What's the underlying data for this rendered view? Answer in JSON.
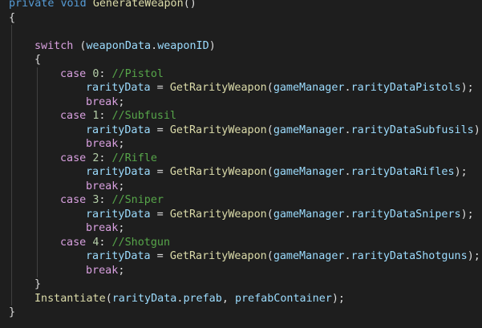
{
  "editor": {
    "lines": [
      {
        "indent": 0,
        "tokens": [
          {
            "t": "private",
            "c": "kw"
          },
          {
            "t": " ",
            "c": "punc"
          },
          {
            "t": "void",
            "c": "kw"
          },
          {
            "t": " ",
            "c": "punc"
          },
          {
            "t": "GenerateWeapon",
            "c": "fn"
          },
          {
            "t": "()",
            "c": "punc"
          }
        ]
      },
      {
        "indent": 0,
        "tokens": [
          {
            "t": "{",
            "c": "punc"
          }
        ]
      },
      {
        "indent": 0,
        "tokens": []
      },
      {
        "indent": 1,
        "tokens": [
          {
            "t": "switch",
            "c": "ctrl"
          },
          {
            "t": " (",
            "c": "punc"
          },
          {
            "t": "weaponData",
            "c": "var"
          },
          {
            "t": ".",
            "c": "punc"
          },
          {
            "t": "weaponID",
            "c": "var"
          },
          {
            "t": ")",
            "c": "punc"
          }
        ]
      },
      {
        "indent": 1,
        "tokens": [
          {
            "t": "{",
            "c": "punc"
          }
        ]
      },
      {
        "indent": 2,
        "tokens": [
          {
            "t": "case",
            "c": "ctrl"
          },
          {
            "t": " ",
            "c": "punc"
          },
          {
            "t": "0",
            "c": "num"
          },
          {
            "t": ": ",
            "c": "punc"
          },
          {
            "t": "//Pistol",
            "c": "cmt"
          }
        ]
      },
      {
        "indent": 3,
        "tokens": [
          {
            "t": "rarityData",
            "c": "var"
          },
          {
            "t": " = ",
            "c": "punc"
          },
          {
            "t": "GetRarityWeapon",
            "c": "fn"
          },
          {
            "t": "(",
            "c": "punc"
          },
          {
            "t": "gameManager",
            "c": "var"
          },
          {
            "t": ".",
            "c": "punc"
          },
          {
            "t": "rarityDataPistols",
            "c": "var"
          },
          {
            "t": ");",
            "c": "punc"
          }
        ]
      },
      {
        "indent": 3,
        "tokens": [
          {
            "t": "break",
            "c": "ctrl"
          },
          {
            "t": ";",
            "c": "punc"
          }
        ]
      },
      {
        "indent": 2,
        "tokens": [
          {
            "t": "case",
            "c": "ctrl"
          },
          {
            "t": " ",
            "c": "punc"
          },
          {
            "t": "1",
            "c": "num"
          },
          {
            "t": ": ",
            "c": "punc"
          },
          {
            "t": "//Subfusil",
            "c": "cmt"
          }
        ]
      },
      {
        "indent": 3,
        "tokens": [
          {
            "t": "rarityData",
            "c": "var"
          },
          {
            "t": " = ",
            "c": "punc"
          },
          {
            "t": "GetRarityWeapon",
            "c": "fn"
          },
          {
            "t": "(",
            "c": "punc"
          },
          {
            "t": "gameManager",
            "c": "var"
          },
          {
            "t": ".",
            "c": "punc"
          },
          {
            "t": "rarityDataSubfusils",
            "c": "var"
          },
          {
            "t": ");",
            "c": "punc"
          }
        ]
      },
      {
        "indent": 3,
        "tokens": [
          {
            "t": "break",
            "c": "ctrl"
          },
          {
            "t": ";",
            "c": "punc"
          }
        ]
      },
      {
        "indent": 2,
        "tokens": [
          {
            "t": "case",
            "c": "ctrl"
          },
          {
            "t": " ",
            "c": "punc"
          },
          {
            "t": "2",
            "c": "num"
          },
          {
            "t": ": ",
            "c": "punc"
          },
          {
            "t": "//Rifle",
            "c": "cmt"
          }
        ]
      },
      {
        "indent": 3,
        "tokens": [
          {
            "t": "rarityData",
            "c": "var"
          },
          {
            "t": " = ",
            "c": "punc"
          },
          {
            "t": "GetRarityWeapon",
            "c": "fn"
          },
          {
            "t": "(",
            "c": "punc"
          },
          {
            "t": "gameManager",
            "c": "var"
          },
          {
            "t": ".",
            "c": "punc"
          },
          {
            "t": "rarityDataRifles",
            "c": "var"
          },
          {
            "t": ");",
            "c": "punc"
          }
        ]
      },
      {
        "indent": 3,
        "tokens": [
          {
            "t": "break",
            "c": "ctrl"
          },
          {
            "t": ";",
            "c": "punc"
          }
        ]
      },
      {
        "indent": 2,
        "tokens": [
          {
            "t": "case",
            "c": "ctrl"
          },
          {
            "t": " ",
            "c": "punc"
          },
          {
            "t": "3",
            "c": "num"
          },
          {
            "t": ": ",
            "c": "punc"
          },
          {
            "t": "//Sniper",
            "c": "cmt"
          }
        ]
      },
      {
        "indent": 3,
        "tokens": [
          {
            "t": "rarityData",
            "c": "var"
          },
          {
            "t": " = ",
            "c": "punc"
          },
          {
            "t": "GetRarityWeapon",
            "c": "fn"
          },
          {
            "t": "(",
            "c": "punc"
          },
          {
            "t": "gameManager",
            "c": "var"
          },
          {
            "t": ".",
            "c": "punc"
          },
          {
            "t": "rarityDataSnipers",
            "c": "var"
          },
          {
            "t": ");",
            "c": "punc"
          }
        ]
      },
      {
        "indent": 3,
        "tokens": [
          {
            "t": "break",
            "c": "ctrl"
          },
          {
            "t": ";",
            "c": "punc"
          }
        ]
      },
      {
        "indent": 2,
        "tokens": [
          {
            "t": "case",
            "c": "ctrl"
          },
          {
            "t": " ",
            "c": "punc"
          },
          {
            "t": "4",
            "c": "num"
          },
          {
            "t": ": ",
            "c": "punc"
          },
          {
            "t": "//Shotgun",
            "c": "cmt"
          }
        ]
      },
      {
        "indent": 3,
        "tokens": [
          {
            "t": "rarityData",
            "c": "var"
          },
          {
            "t": " = ",
            "c": "punc"
          },
          {
            "t": "GetRarityWeapon",
            "c": "fn"
          },
          {
            "t": "(",
            "c": "punc"
          },
          {
            "t": "gameManager",
            "c": "var"
          },
          {
            "t": ".",
            "c": "punc"
          },
          {
            "t": "rarityDataShotguns",
            "c": "var"
          },
          {
            "t": ");",
            "c": "punc"
          }
        ]
      },
      {
        "indent": 3,
        "tokens": [
          {
            "t": "break",
            "c": "ctrl"
          },
          {
            "t": ";",
            "c": "punc"
          }
        ]
      },
      {
        "indent": 1,
        "tokens": [
          {
            "t": "}",
            "c": "punc"
          }
        ]
      },
      {
        "indent": 1,
        "tokens": [
          {
            "t": "Instantiate",
            "c": "fn"
          },
          {
            "t": "(",
            "c": "punc"
          },
          {
            "t": "rarityData",
            "c": "var"
          },
          {
            "t": ".",
            "c": "punc"
          },
          {
            "t": "prefab",
            "c": "var"
          },
          {
            "t": ", ",
            "c": "punc"
          },
          {
            "t": "prefabContainer",
            "c": "var"
          },
          {
            "t": ");",
            "c": "punc"
          }
        ]
      },
      {
        "indent": 0,
        "tokens": [
          {
            "t": "}",
            "c": "punc"
          }
        ]
      }
    ]
  }
}
